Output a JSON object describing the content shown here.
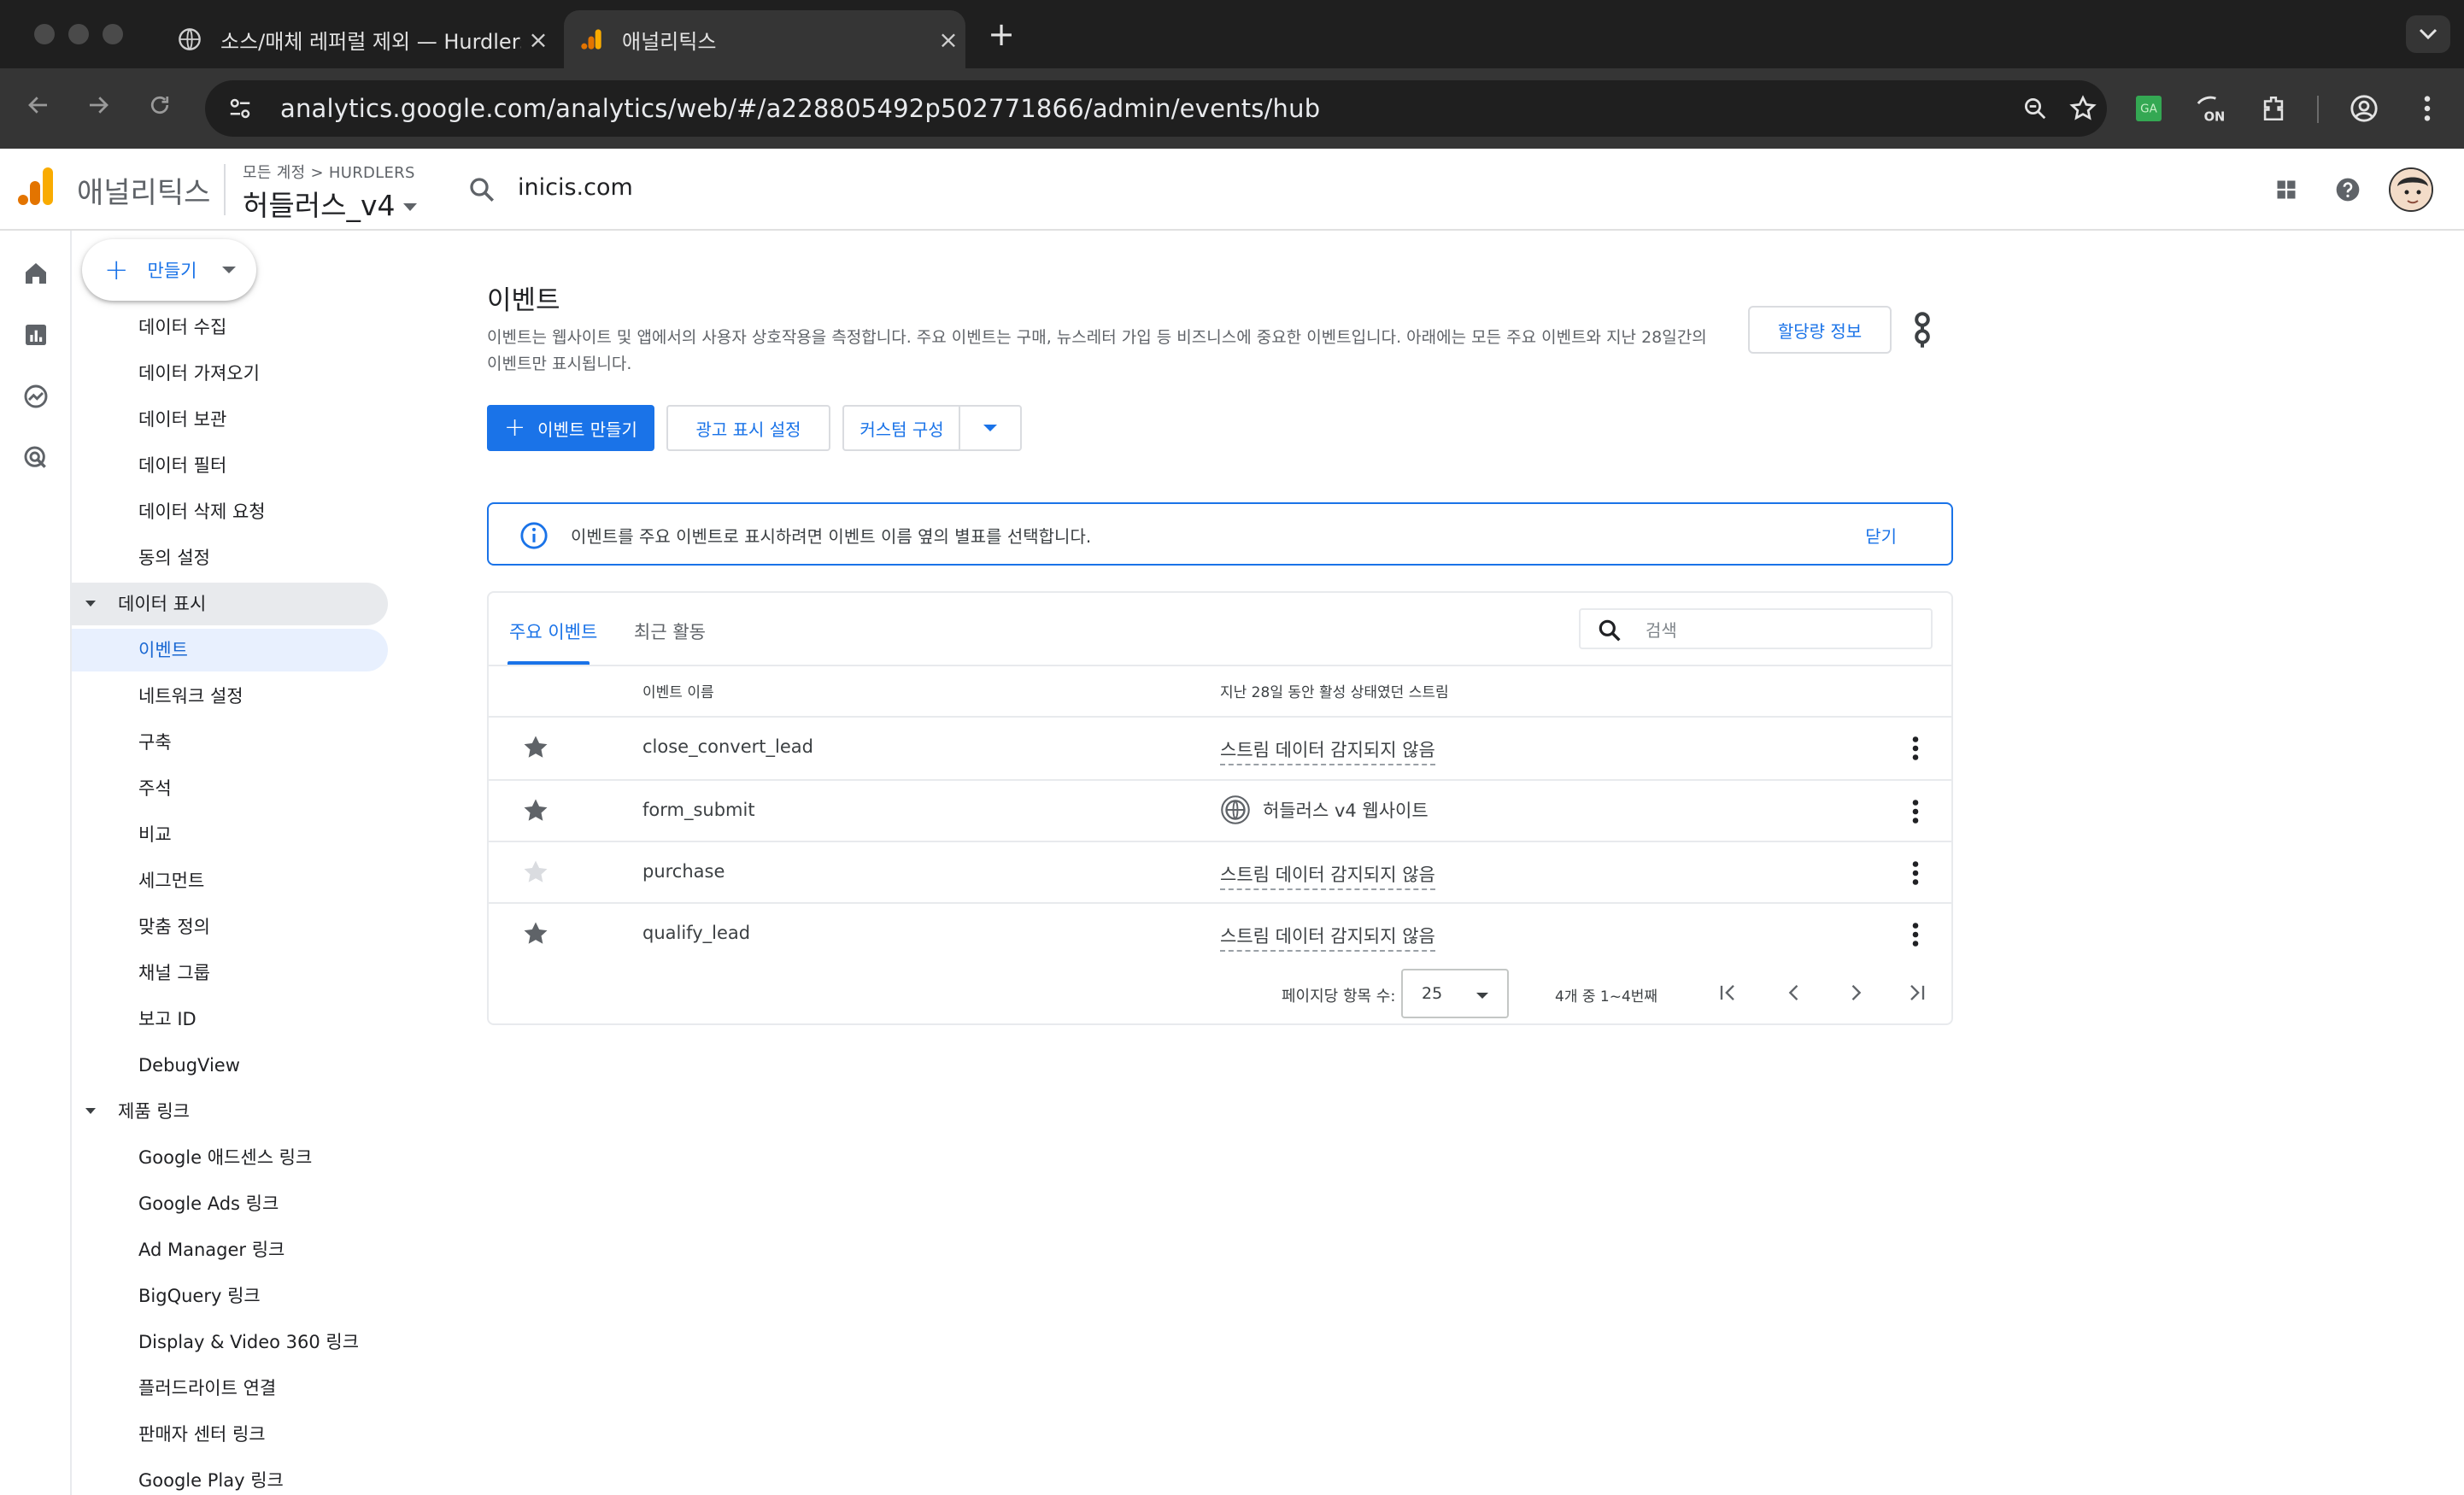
{
  "browser": {
    "tabs": [
      {
        "title": "소스/매체 레퍼럴 제외 — Hurdlers",
        "active": false
      },
      {
        "title": "애널리틱스",
        "active": true
      }
    ],
    "url": "analytics.google.com/analytics/web/#/a228805492p502771866/admin/events/hub",
    "extension_badge": "ON"
  },
  "header": {
    "app_name": "애널리틱스",
    "breadcrumb": "모든 계정 > HURDLERS",
    "property": "허들러스_v4",
    "search_text": "inicis.com"
  },
  "admin_nav": {
    "create_label": "만들기",
    "items_top": [
      "데이터 수집",
      "데이터 가져오기",
      "데이터 보관",
      "데이터 필터",
      "데이터 삭제 요청",
      "동의 설정"
    ],
    "group_display": "데이터 표시",
    "display_items": [
      "이벤트",
      "네트워크 설정",
      "구축",
      "주석",
      "비교",
      "세그먼트",
      "맞춤 정의",
      "채널 그룹",
      "보고 ID",
      "DebugView"
    ],
    "group_links": "제품 링크",
    "link_items": [
      "Google 애드센스 링크",
      "Google Ads 링크",
      "Ad Manager 링크",
      "BigQuery 링크",
      "Display & Video 360 링크",
      "플러드라이트 연결",
      "판매자 센터 링크",
      "Google Play 링크"
    ]
  },
  "page": {
    "title": "이벤트",
    "description": "이벤트는 웹사이트 및 앱에서의 사용자 상호작용을 측정합니다. 주요 이벤트는 구매, 뉴스레터 가입 등 비즈니스에 중요한 이벤트입니다. 아래에는 모든 주요 이벤트와 지난 28일간의 이벤트만 표시됩니다.",
    "quota_button": "할당량 정보",
    "create_event_button": "이벤트 만들기",
    "ad_settings_button": "광고 표시 설정",
    "custom_button": "커스텀 구성"
  },
  "banner": {
    "message": "이벤트를 주요 이벤트로 표시하려면 이벤트 이름 옆의 별표를 선택합니다.",
    "close": "닫기"
  },
  "events_card": {
    "tab_key": "주요 이벤트",
    "tab_recent": "최근 활동",
    "search_placeholder": "검색",
    "col_name": "이벤트 이름",
    "col_stream": "지난 28일 동안 활성 상태였던 스트림",
    "rows": [
      {
        "name": "close_convert_lead",
        "stream": "스트림 데이터 감지되지 않음",
        "starred": true
      },
      {
        "name": "form_submit",
        "stream": "허들러스 v4 웹사이트",
        "starred": true
      },
      {
        "name": "purchase",
        "stream": "스트림 데이터 감지되지 않음",
        "starred": false
      },
      {
        "name": "qualify_lead",
        "stream": "스트림 데이터 감지되지 않음",
        "starred": true
      }
    ],
    "pager": {
      "per_page_label": "페이지당 항목 수:",
      "per_page_value": "25",
      "range": "4개 중 1~4번째"
    }
  },
  "colors": {
    "accent": "#1a73e8",
    "star_active": "#5f6368",
    "star_inactive": "#dadce0"
  }
}
